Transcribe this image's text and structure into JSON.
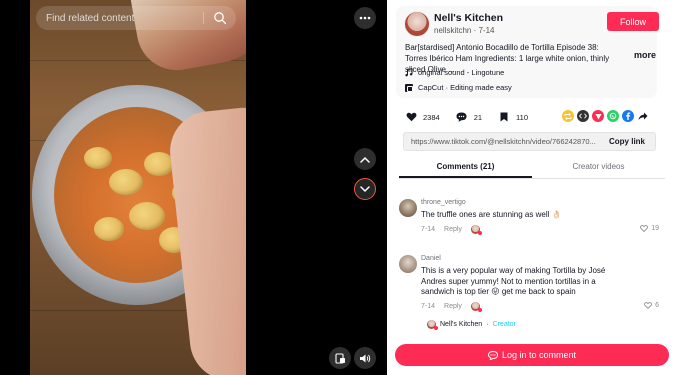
{
  "video": {
    "search_placeholder": "Find related content",
    "icons": [
      "search-icon",
      "more-icon",
      "chevron-up-icon",
      "chevron-down-icon",
      "mini-player-icon",
      "volume-icon"
    ]
  },
  "author": {
    "name": "Nell's Kitchen",
    "handle_date": "nellskitchn · 7-14",
    "follow_label": "Follow"
  },
  "description": {
    "text": "Bar[stardised] Antonio Bocadillo de Tortilla Episode 38: Torres Ibérico Ham Ingredients: 1 large white onion, thinly sliced Olive ...",
    "more_label": "more"
  },
  "sound": {
    "label": "original sound - Lingotune"
  },
  "capcut": {
    "label": "CapCut · Editing made easy"
  },
  "stats": {
    "likes": "2384",
    "comments": "21",
    "saves": "110"
  },
  "share": {
    "icons": [
      "repost-icon",
      "embed-icon",
      "send-icon",
      "whatsapp-icon",
      "facebook-icon",
      "share-arrow-icon"
    ],
    "colors": {
      "repost": "#f6c334",
      "embed": "#333333",
      "send": "#fe2c55",
      "whatsapp": "#25d366",
      "facebook": "#1877f2"
    }
  },
  "link": {
    "url": "https://www.tiktok.com/@nellskitchn/video/766242870...",
    "copy_label": "Copy link"
  },
  "tabs": [
    {
      "label": "Comments (21)",
      "active": true
    },
    {
      "label": "Creator videos",
      "active": false
    }
  ],
  "comments": [
    {
      "user": "throne_vertigo",
      "text": "The truffle ones are stunning as well 👌🏻",
      "date": "7-14",
      "reply_label": "Reply",
      "likes": "19"
    },
    {
      "user": "Daniel",
      "text": "This is a very popular way of making Tortilla by José Andres super yummy! Not to mention tortillas in a sandwich is top tier 😛 get me back to spain",
      "date": "7-14",
      "reply_label": "Reply",
      "likes": "6"
    }
  ],
  "reply_preview": {
    "name": "Nell's Kitchen",
    "dot": " · ",
    "tag": "Creator"
  },
  "login": {
    "label": "Log in to comment"
  },
  "colors": {
    "brand": "#fe2c55",
    "creator_tag": "#20d5ec"
  }
}
